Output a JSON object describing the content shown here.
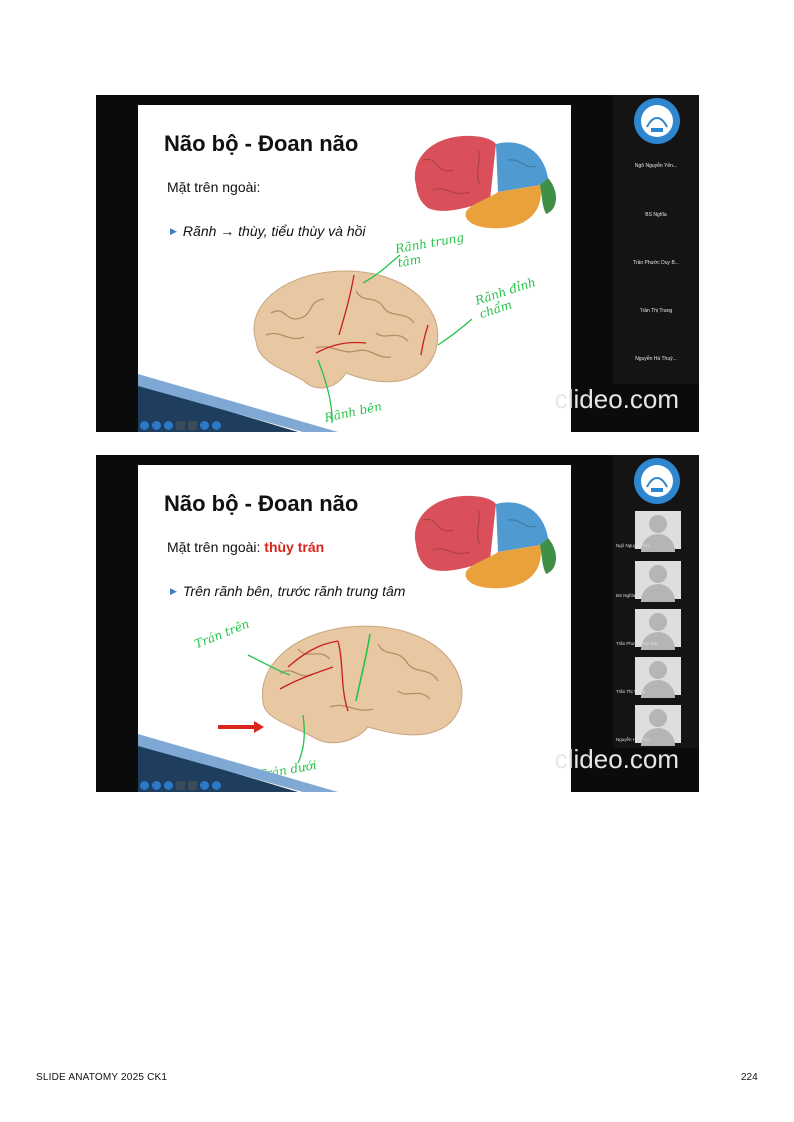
{
  "slides": [
    {
      "title": "Não bộ - Đoan não",
      "subtitle": "Mặt trên ngoài:",
      "bullet": "Rãnh → thùy, tiểu thùy và hồi",
      "handwriting": [
        "Rãnh trung tâm",
        "Rãnh đỉnh chẩm",
        "Rãnh bên"
      ],
      "participants": [
        "Ngô Nguyễn Yến...",
        "BS Nghĩa",
        "Trần Phước Duy B...",
        "Trần Thị Trang",
        "Nguyễn Hà Thuý..."
      ],
      "watermark": "clideo.com"
    },
    {
      "title": "Não bộ - Đoan não",
      "subtitle_prefix": "Mặt trên ngoài: ",
      "subtitle_highlight": "thùy trán",
      "bullet": "Trên rãnh bên, trước rãnh trung tâm",
      "handwriting": [
        "Trán trên",
        "Trán dưới"
      ],
      "participants": [
        "Ngô Nguyễn Yến...",
        "BS Nghĩa",
        "Trần Phước Duy Bảo",
        "Trần Thị Trang",
        "Nguyễn Hà Thuý..."
      ],
      "watermark": "clideo.com"
    }
  ],
  "footer": {
    "left": "SLIDE ANATOMY 2025 CK1",
    "page": "224"
  },
  "colors": {
    "frontal": "#d9505a",
    "parietal": "#4e9ad1",
    "temporal": "#e9a23b",
    "occipital": "#3f8f45",
    "sulcus_red": "#c8201a",
    "annotation_green": "#25c247"
  }
}
